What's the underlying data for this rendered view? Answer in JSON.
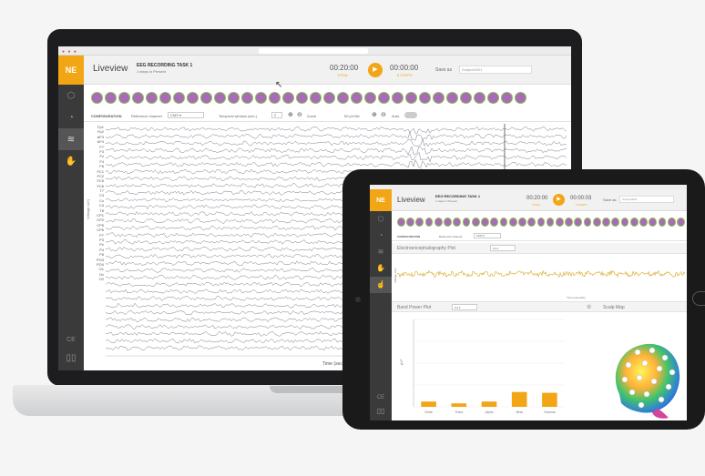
{
  "laptop": {
    "app": {
      "logo": "NE",
      "page_title": "Liveview",
      "task_title": "EEG RECORDING TASK 1",
      "task_subtitle": "1 steps in Present",
      "time_elapsed": "00:20:00",
      "time_elapsed_sub": "TOTAL",
      "time_remaining": "00:00:00",
      "time_remaining_sub": "8 STEPS",
      "save_as_label": "Save as",
      "save_as_value": "Subject0001",
      "config": {
        "heading": "CONFIGURATION",
        "reference_label": "Reference channel",
        "reference_value": "CMS",
        "temporal_label": "Temporal window (sec.)",
        "temporal_value": "2",
        "zoom_label": "Zoom",
        "scale_label": "50 µV/div",
        "auto_label": "Auto"
      },
      "ylabel": "Voltage (uV)",
      "xlabel": "Time (sec)",
      "side_ce": "CE",
      "channels": [
        "Fp1",
        "Fp2",
        "AF3",
        "AF4",
        "F7",
        "F3",
        "Fz",
        "F4",
        "F8",
        "FC1",
        "FC2",
        "FC5",
        "FC6",
        "T7",
        "C3",
        "Cz",
        "C4",
        "T8",
        "CP1",
        "CP2",
        "CP5",
        "CP6",
        "P7",
        "P3",
        "Pz",
        "P4",
        "P8",
        "PO3",
        "PO4",
        "O1",
        "Oz",
        "O2"
      ]
    },
    "channel_icon_count": 32
  },
  "tablet": {
    "app": {
      "logo": "NE",
      "page_title": "Liveview",
      "task_title": "EEG RECORDING TASK 1",
      "task_subtitle": "1 steps in Present",
      "time_elapsed": "00:20:00",
      "time_elapsed_sub": "TOTAL",
      "time_remaining": "00:00:03",
      "time_remaining_sub": "8 STEPS",
      "save_as_label": "Save as",
      "save_as_value": "Subject0001",
      "config_heading": "CONFIGURATION",
      "reference_label": "Reference channel",
      "reference_value": "CMS",
      "eeg_panel_label": "Electroencephalography Plot",
      "eeg_channel_value": "O1",
      "eeg_ylabel": "Voltage (uV)",
      "eeg_xlabel": "Time (seconds)",
      "bp_panel_label": "Band Power Plot",
      "bp_select_value": "O1",
      "scalp_label": "Scalp Map",
      "side_ce": "CE"
    },
    "channel_icon_count": 31
  },
  "chart_data": {
    "type": "bar",
    "categories": [
      "Delta",
      "Theta",
      "Alpha",
      "Beta",
      "Gamma"
    ],
    "values": [
      6,
      4,
      6,
      17,
      16
    ],
    "ylim": [
      0,
      100
    ],
    "ylabel": "µV²",
    "color": "#f2a515"
  },
  "colors": {
    "accent": "#f2a515",
    "sidebar": "#3a3a3a",
    "channel_ok_fill": "#a86bb6",
    "channel_ok_ring": "#8cc152"
  }
}
